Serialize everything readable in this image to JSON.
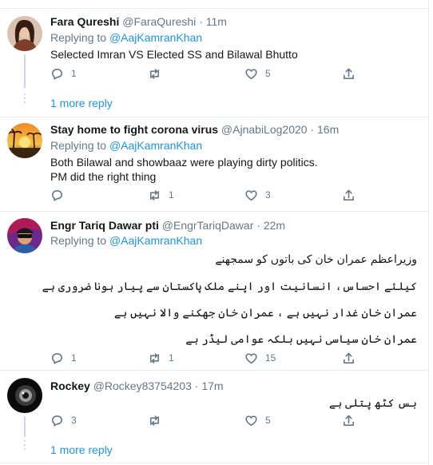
{
  "tweets": [
    {
      "name": "Fara Qureshi",
      "handle": "@FaraQureshi",
      "sep": "·",
      "time": "11m",
      "replying_label": "Replying to",
      "replying_to": "@AajKamranKhan",
      "text_lines": [
        "Selected Imran VS Elected SS and Bilawal Bhutto"
      ],
      "reply_count": "1",
      "retweet_count": "",
      "like_count": "5",
      "show_more": "1 more reply"
    },
    {
      "name": "Stay home to fight corona virus",
      "handle": "@AjnabiLog2020",
      "sep": "·",
      "time": "16m",
      "replying_label": "Replying to",
      "replying_to": "@AajKamranKhan",
      "text_lines": [
        "Both Bilawal and showbaaz were playing dirty politics.",
        "PM did the right thing"
      ],
      "reply_count": "",
      "retweet_count": "1",
      "like_count": "3"
    },
    {
      "name": "Engr Tariq Dawar pti",
      "handle": "@EngrTariqDawar",
      "sep": "·",
      "time": "22m",
      "replying_label": "Replying to",
      "replying_to": "@AajKamranKhan",
      "text_lines": [
        "وزیراعظم عمران خان کی باتوں کو سمجھنے",
        "کیلئے احساس، انسانیت اور اپنے ملک پاکستان سے پیار ہونا ضروری ہے",
        "عمران خان غدار نہیں ہے ، عمران خان جھکنے والا نہیں ہے",
        "عمران خان سیاسی نہیں بلکہ عوامی لیڈر ہے"
      ],
      "reply_count": "1",
      "retweet_count": "1",
      "like_count": "15"
    },
    {
      "name": "Rockey",
      "handle": "@Rockey83754203",
      "sep": "·",
      "time": "17m",
      "text_lines": [
        "بس کٹھ پتلی ہے"
      ],
      "reply_count": "3",
      "retweet_count": "",
      "like_count": "5",
      "show_more": "1 more reply"
    }
  ],
  "icons": {
    "reply": "reply-icon",
    "retweet": "retweet-icon",
    "like": "like-icon",
    "share": "share-icon"
  },
  "colors": {
    "link": "#1b95e0",
    "muted": "#657786",
    "border": "#e6ecf0"
  }
}
